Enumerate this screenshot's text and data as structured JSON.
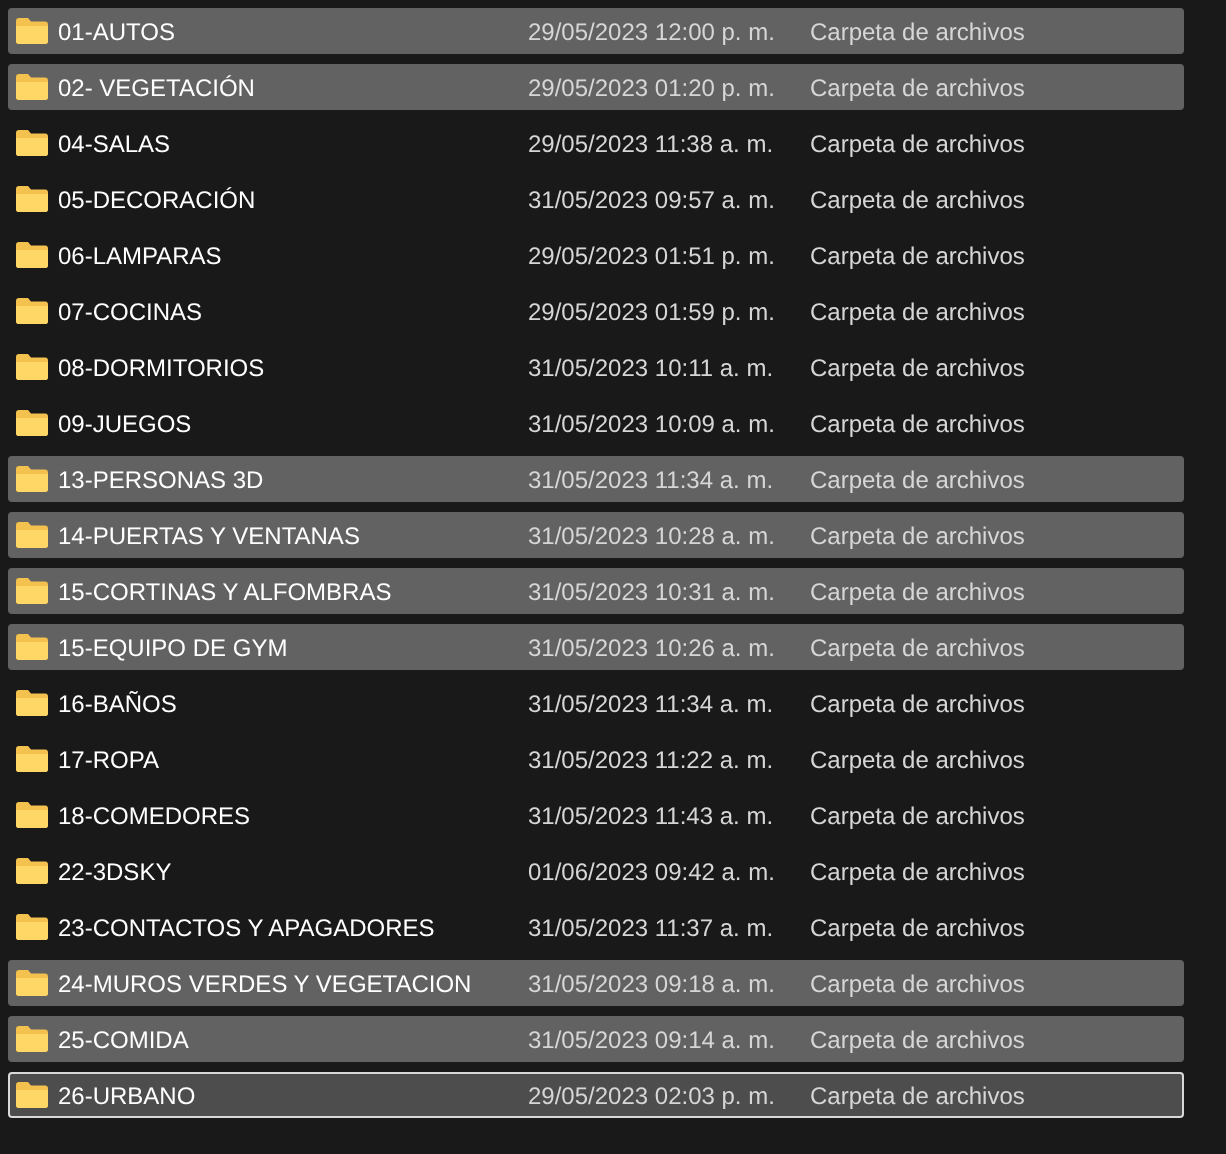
{
  "files": [
    {
      "name": "01-AUTOS",
      "date": "29/05/2023 12:00 p. m.",
      "type": "Carpeta de archivos",
      "selected": true,
      "focused": false
    },
    {
      "name": "02- VEGETACIÓN",
      "date": "29/05/2023 01:20 p. m.",
      "type": "Carpeta de archivos",
      "selected": true,
      "focused": false
    },
    {
      "name": "04-SALAS",
      "date": "29/05/2023 11:38 a. m.",
      "type": "Carpeta de archivos",
      "selected": false,
      "focused": false
    },
    {
      "name": "05-DECORACIÓN",
      "date": "31/05/2023 09:57 a. m.",
      "type": "Carpeta de archivos",
      "selected": false,
      "focused": false
    },
    {
      "name": "06-LAMPARAS",
      "date": "29/05/2023 01:51 p. m.",
      "type": "Carpeta de archivos",
      "selected": false,
      "focused": false
    },
    {
      "name": "07-COCINAS",
      "date": "29/05/2023 01:59 p. m.",
      "type": "Carpeta de archivos",
      "selected": false,
      "focused": false
    },
    {
      "name": "08-DORMITORIOS",
      "date": "31/05/2023 10:11 a. m.",
      "type": "Carpeta de archivos",
      "selected": false,
      "focused": false
    },
    {
      "name": "09-JUEGOS",
      "date": "31/05/2023 10:09 a. m.",
      "type": "Carpeta de archivos",
      "selected": false,
      "focused": false
    },
    {
      "name": "13-PERSONAS 3D",
      "date": "31/05/2023 11:34 a. m.",
      "type": "Carpeta de archivos",
      "selected": true,
      "focused": false
    },
    {
      "name": "14-PUERTAS Y VENTANAS",
      "date": "31/05/2023 10:28 a. m.",
      "type": "Carpeta de archivos",
      "selected": true,
      "focused": false
    },
    {
      "name": "15-CORTINAS Y ALFOMBRAS",
      "date": "31/05/2023 10:31 a. m.",
      "type": "Carpeta de archivos",
      "selected": true,
      "focused": false
    },
    {
      "name": "15-EQUIPO DE GYM",
      "date": "31/05/2023 10:26 a. m.",
      "type": "Carpeta de archivos",
      "selected": true,
      "focused": false
    },
    {
      "name": "16-BAÑOS",
      "date": "31/05/2023 11:34 a. m.",
      "type": "Carpeta de archivos",
      "selected": false,
      "focused": false
    },
    {
      "name": "17-ROPA",
      "date": "31/05/2023 11:22 a. m.",
      "type": "Carpeta de archivos",
      "selected": false,
      "focused": false
    },
    {
      "name": "18-COMEDORES",
      "date": "31/05/2023 11:43 a. m.",
      "type": "Carpeta de archivos",
      "selected": false,
      "focused": false
    },
    {
      "name": "22-3DSKY",
      "date": "01/06/2023 09:42 a. m.",
      "type": "Carpeta de archivos",
      "selected": false,
      "focused": false
    },
    {
      "name": "23-CONTACTOS Y APAGADORES",
      "date": "31/05/2023 11:37 a. m.",
      "type": "Carpeta de archivos",
      "selected": false,
      "focused": false
    },
    {
      "name": "24-MUROS VERDES Y VEGETACION",
      "date": "31/05/2023 09:18 a. m.",
      "type": "Carpeta de archivos",
      "selected": true,
      "focused": false
    },
    {
      "name": "25-COMIDA",
      "date": "31/05/2023 09:14 a. m.",
      "type": "Carpeta de archivos",
      "selected": true,
      "focused": false
    },
    {
      "name": "26-URBANO",
      "date": "29/05/2023 02:03 p. m.",
      "type": "Carpeta de archivos",
      "selected": true,
      "focused": true
    }
  ]
}
